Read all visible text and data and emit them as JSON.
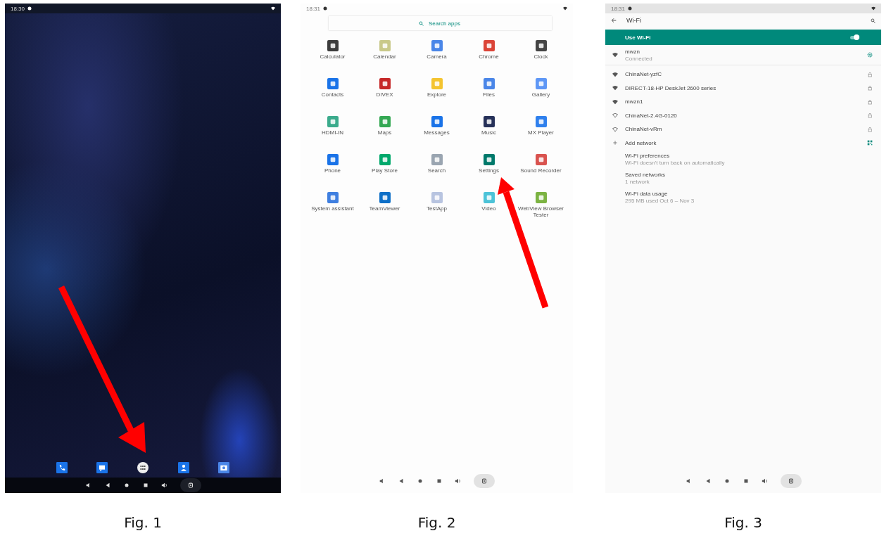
{
  "figures": [
    {
      "kind": "home",
      "status_time": "18:30",
      "caption": "Fig. 1"
    },
    {
      "kind": "apps",
      "status_time": "18:31",
      "search": {
        "placeholder": "Search apps"
      },
      "apps": [
        {
          "label": "Calculator",
          "color": "#3c3c3c"
        },
        {
          "label": "Calendar",
          "color": "#c9c98a"
        },
        {
          "label": "Camera",
          "color": "#4a86e8"
        },
        {
          "label": "Chrome",
          "color": "#db4437"
        },
        {
          "label": "Clock",
          "color": "#444444"
        },
        {
          "label": "Contacts",
          "color": "#1a73e8"
        },
        {
          "label": "DIVEX",
          "color": "#c62828"
        },
        {
          "label": "Explore",
          "color": "#f4c430"
        },
        {
          "label": "Files",
          "color": "#4a86e8"
        },
        {
          "label": "Gallery",
          "color": "#5e97f6"
        },
        {
          "label": "HDMI-IN",
          "color": "#3bab8c"
        },
        {
          "label": "Maps",
          "color": "#34a853"
        },
        {
          "label": "Messages",
          "color": "#1a73e8"
        },
        {
          "label": "Music",
          "color": "#263159"
        },
        {
          "label": "MX Player",
          "color": "#2f80ed"
        },
        {
          "label": "Phone",
          "color": "#1a73e8"
        },
        {
          "label": "Play Store",
          "color": "#00a86b"
        },
        {
          "label": "Search",
          "color": "#9aa5b1"
        },
        {
          "label": "Settings",
          "color": "#00796b"
        },
        {
          "label": "Sound Recorder",
          "color": "#d9534f"
        },
        {
          "label": "System assistant",
          "color": "#3f7fe0"
        },
        {
          "label": "TeamViewer",
          "color": "#0e6fc7"
        },
        {
          "label": "TestApp",
          "color": "#b8c4e0"
        },
        {
          "label": "Video",
          "color": "#4dc3d8"
        },
        {
          "label": "WebView Browser Tester",
          "color": "#7cb342"
        }
      ],
      "caption": "Fig. 2"
    },
    {
      "kind": "wifi",
      "status_time": "18:31",
      "title": "Wi-Fi",
      "master": {
        "label": "Use Wi-Fi",
        "on": true
      },
      "networks": [
        {
          "name": "mwzn",
          "status": "Connected",
          "kind": "connected"
        },
        {
          "name": "ChinaNet-yzfC",
          "kind": "secured"
        },
        {
          "name": "DIRECT-18-HP DeskJet 2600 series",
          "kind": "secured"
        },
        {
          "name": "mwzn1",
          "kind": "secured"
        },
        {
          "name": "ChinaNet-2.4G-0120",
          "kind": "secured"
        },
        {
          "name": "ChinaNet-vRm",
          "kind": "secured"
        }
      ],
      "add_network": "Add network",
      "preferences": [
        {
          "title": "Wi-Fi preferences",
          "summary": "Wi-Fi doesn't turn back on automatically"
        },
        {
          "title": "Saved networks",
          "summary": "1 network"
        },
        {
          "title": "Wi-Fi data usage",
          "summary": "295 MB used Oct 6 – Nov 3"
        }
      ],
      "caption": "Fig. 3"
    }
  ]
}
